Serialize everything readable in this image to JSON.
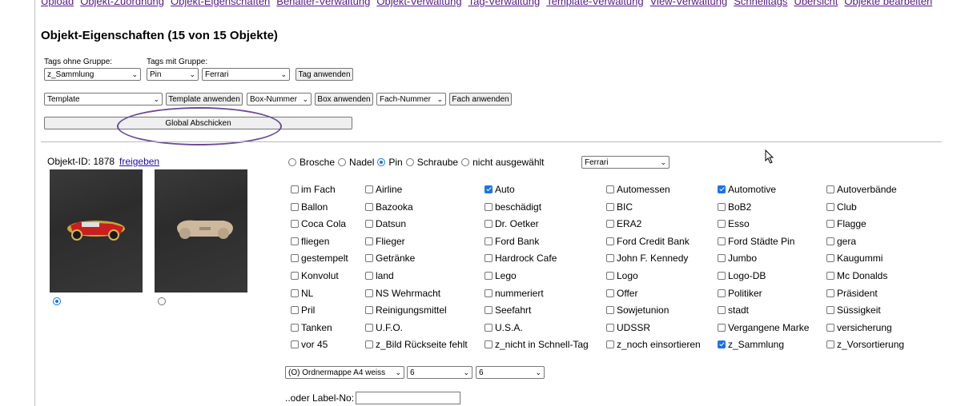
{
  "nav": [
    "Upload",
    "Objekt-Zuordnung",
    "Objekt-Eigenschaften",
    "Behälter-Verwaltung",
    "Objekt-Verwaltung",
    "Tag-Verwaltung",
    "Template-Verwaltung",
    "View-Verwaltung",
    "Schnelltags",
    "Übersicht",
    "Objekte bearbeiten"
  ],
  "page_title": "Objekt-Eigenschaften (15 von 15 Objekte)",
  "tags": {
    "ohne_label": "Tags ohne Gruppe:",
    "mit_label": "Tags mit Gruppe:",
    "ohne_value": "z_Sammlung",
    "gruppe_value": "Pin",
    "tag_value": "Ferrari",
    "apply": "Tag anwenden"
  },
  "template": {
    "value": "Template",
    "apply": "Template anwenden",
    "box_value": "Box-Nummer",
    "box_apply": "Box anwenden",
    "fach_value": "Fach-Nummer",
    "fach_apply": "Fach anwenden"
  },
  "global_submit": "Global Abschicken",
  "object": {
    "id_label": "Objekt-ID: 1878",
    "release": "freigeben"
  },
  "radios": [
    {
      "label": "Brosche",
      "checked": false
    },
    {
      "label": "Nadel",
      "checked": false
    },
    {
      "label": "Pin",
      "checked": true
    },
    {
      "label": "Schraube",
      "checked": false
    },
    {
      "label": "nicht ausgewählt",
      "checked": false
    }
  ],
  "radio_select": "Ferrari",
  "checkboxes": [
    [
      {
        "l": "im Fach",
        "c": false
      },
      {
        "l": "Airline",
        "c": false
      },
      {
        "l": "Auto",
        "c": true
      },
      {
        "l": "Automessen",
        "c": false
      },
      {
        "l": "Automotive",
        "c": true
      },
      {
        "l": "Autoverbände",
        "c": false
      }
    ],
    [
      {
        "l": "Ballon",
        "c": false
      },
      {
        "l": "Bazooka",
        "c": false
      },
      {
        "l": "beschädigt",
        "c": false
      },
      {
        "l": "BIC",
        "c": false
      },
      {
        "l": "BoB2",
        "c": false
      },
      {
        "l": "Club",
        "c": false
      }
    ],
    [
      {
        "l": "Coca Cola",
        "c": false
      },
      {
        "l": "Datsun",
        "c": false
      },
      {
        "l": "Dr. Oetker",
        "c": false
      },
      {
        "l": "ERA2",
        "c": false
      },
      {
        "l": "Esso",
        "c": false
      },
      {
        "l": "Flagge",
        "c": false
      }
    ],
    [
      {
        "l": "fliegen",
        "c": false
      },
      {
        "l": "Flieger",
        "c": false
      },
      {
        "l": "Ford Bank",
        "c": false
      },
      {
        "l": "Ford Credit Bank",
        "c": false
      },
      {
        "l": "Ford Städte Pin",
        "c": false
      },
      {
        "l": "gera",
        "c": false
      }
    ],
    [
      {
        "l": "gestempelt",
        "c": false
      },
      {
        "l": "Getränke",
        "c": false
      },
      {
        "l": "Hardrock Cafe",
        "c": false
      },
      {
        "l": "John F. Kennedy",
        "c": false
      },
      {
        "l": "Jumbo",
        "c": false
      },
      {
        "l": "Kaugummi",
        "c": false
      }
    ],
    [
      {
        "l": "Konvolut",
        "c": false
      },
      {
        "l": "land",
        "c": false
      },
      {
        "l": "Lego",
        "c": false
      },
      {
        "l": "Logo",
        "c": false
      },
      {
        "l": "Logo-DB",
        "c": false
      },
      {
        "l": "Mc Donalds",
        "c": false
      }
    ],
    [
      {
        "l": "NL",
        "c": false
      },
      {
        "l": "NS Wehrmacht",
        "c": false
      },
      {
        "l": "nummeriert",
        "c": false
      },
      {
        "l": "Offer",
        "c": false
      },
      {
        "l": "Politiker",
        "c": false
      },
      {
        "l": "Präsident",
        "c": false
      }
    ],
    [
      {
        "l": "Pril",
        "c": false
      },
      {
        "l": "Reinigungsmittel",
        "c": false
      },
      {
        "l": "Seefahrt",
        "c": false
      },
      {
        "l": "Sowjetunion",
        "c": false
      },
      {
        "l": "stadt",
        "c": false
      },
      {
        "l": "Süssigkeit",
        "c": false
      }
    ],
    [
      {
        "l": "Tanken",
        "c": false
      },
      {
        "l": "U.F.O.",
        "c": false
      },
      {
        "l": "U.S.A.",
        "c": false
      },
      {
        "l": "UDSSR",
        "c": false
      },
      {
        "l": "Vergangene Marke",
        "c": false
      },
      {
        "l": "versicherung",
        "c": false
      }
    ],
    [
      {
        "l": "vor 45",
        "c": false
      },
      {
        "l": "z_Bild Rückseite fehlt",
        "c": false
      },
      {
        "l": "z_nicht in Schnell-Tag",
        "c": false
      },
      {
        "l": "z_noch einsortieren",
        "c": false
      },
      {
        "l": "z_Sammlung",
        "c": true
      },
      {
        "l": "z_Vorsortierung",
        "c": false
      }
    ]
  ],
  "storage": {
    "ordner": "(O) Ordnermappe A4 weiss",
    "box": "6",
    "fach": "6"
  },
  "label_no": "..oder Label-No:"
}
